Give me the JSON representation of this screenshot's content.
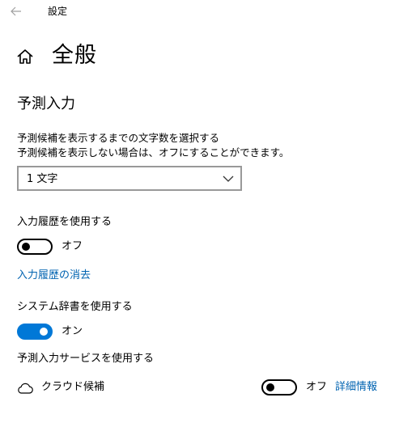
{
  "window": {
    "title": "設定"
  },
  "header": {
    "title": "全般"
  },
  "section": {
    "title": "予測入力"
  },
  "candidates": {
    "description_line1": "予測候補を表示するまでの文字数を選択する",
    "description_line2": "予測候補を表示しない場合は、オフにすることができます。",
    "dropdown_value": "1 文字"
  },
  "history": {
    "label": "入力履歴を使用する",
    "toggle_state": "オフ",
    "clear_link": "入力履歴の消去"
  },
  "system_dictionary": {
    "label": "システム辞書を使用する",
    "toggle_state": "オン"
  },
  "prediction_service": {
    "label": "予測入力サービスを使用する",
    "cloud_label": "クラウド候補",
    "toggle_state": "オフ",
    "details_link": "詳細情報"
  },
  "colors": {
    "accent": "#0078d7",
    "link": "#0063b1"
  },
  "icons": [
    "back-arrow-icon",
    "home-icon",
    "chevron-down-icon",
    "cloud-icon"
  ]
}
